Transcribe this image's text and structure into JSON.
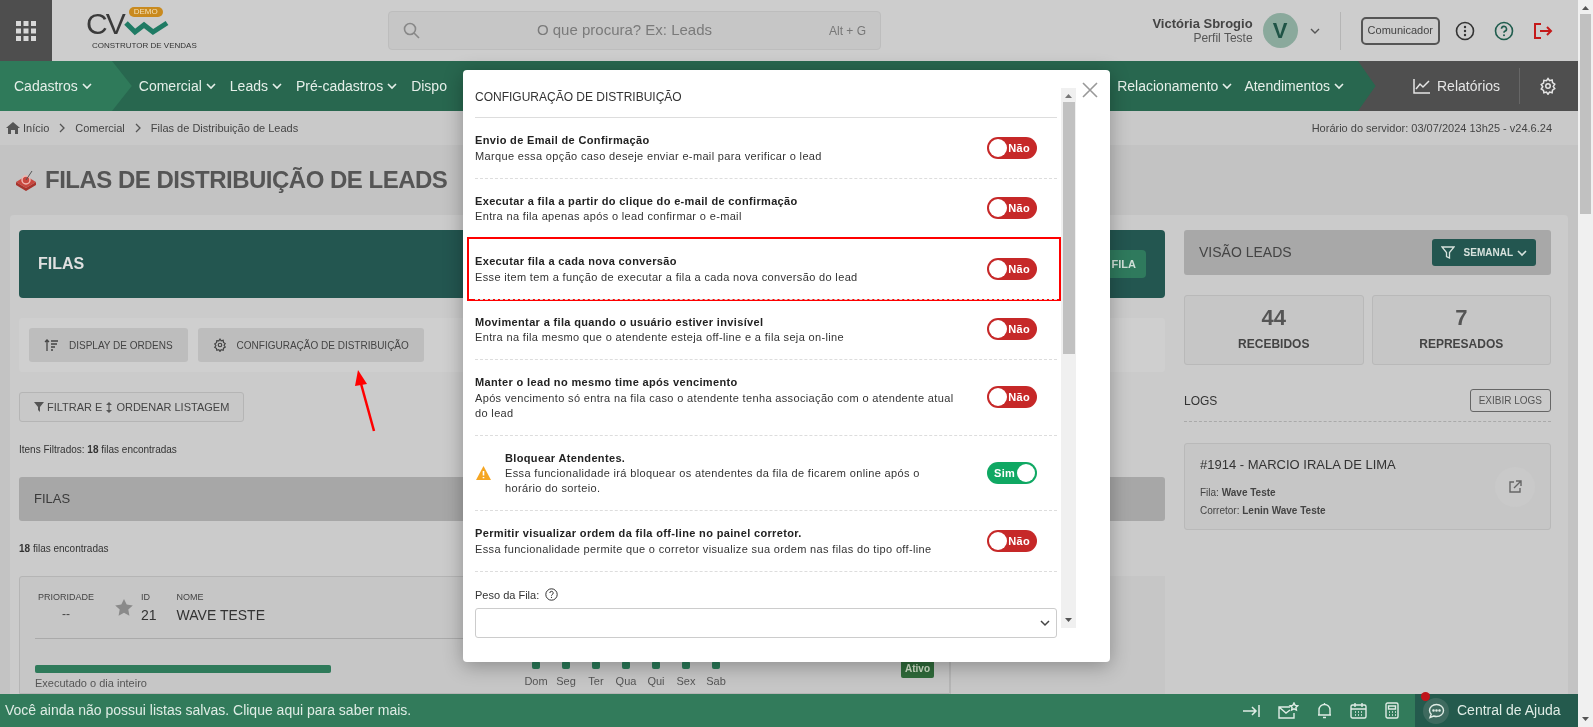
{
  "header": {
    "logo": {
      "mark": "CV",
      "badge": "DEMO",
      "tagline": "CONSTRUTOR DE VENDAS"
    },
    "search": {
      "placeholder": "O que procura? Ex: Leads",
      "shortcut": "Alt + G"
    },
    "user": {
      "name": "Victória Sbrogio",
      "profile": "Perfil Teste",
      "initial": "V"
    },
    "communicator": "Comunicador"
  },
  "nav": {
    "items": [
      {
        "label": "Cadastros",
        "menu": true,
        "selected": true
      },
      {
        "label": "Comercial",
        "menu": true,
        "selected": false
      },
      {
        "label": "Leads",
        "menu": true,
        "selected": false
      },
      {
        "label": "Pré-cadastros",
        "menu": true,
        "selected": false
      },
      {
        "label": "Dispo",
        "menu": false,
        "selected": false
      }
    ],
    "right_items": [
      {
        "label": "Relacionamento",
        "menu": true
      },
      {
        "label": "Atendimentos",
        "menu": true
      }
    ],
    "reports": "Relatórios"
  },
  "breadcrumb": [
    "Início",
    "Comercial",
    "Filas de Distribuição de Leads"
  ],
  "server_time": "Horário do servidor: 03/07/2024 13h25 - v24.6.24",
  "page_title": "FILAS DE DISTRIBUIÇÃO DE LEADS",
  "filas_header": {
    "title": "FILAS",
    "button": "FILA"
  },
  "toolbar": [
    "DISPLAY DE ORDENS",
    "CONFIGURAÇÃO DE DISTRIBUIÇÃO"
  ],
  "filter_button": {
    "left": "FILTRAR E",
    "right": "ORDENAR LISTAGEM"
  },
  "filtered": "Itens Filtrados: **18** filas encontradas",
  "list_title": "FILAS",
  "found": "**18** filas encontradas",
  "queue": {
    "priority_label": "PRIORIDADE",
    "priority": "--",
    "starred": false,
    "id_label": "ID",
    "id": "21",
    "name_label": "NOME",
    "name": "WAVE TESTE",
    "level": 1,
    "schedule": "Executado o dia inteiro",
    "days": [
      {
        "label": "Dom",
        "active": true
      },
      {
        "label": "Seg",
        "active": true
      },
      {
        "label": "Ter",
        "active": true
      },
      {
        "label": "Qua",
        "active": true
      },
      {
        "label": "Qui",
        "active": true
      },
      {
        "label": "Sex",
        "active": true
      },
      {
        "label": "Sab",
        "active": true
      }
    ],
    "status": "Ativo"
  },
  "leads_view": {
    "title": "VISÃO LEADS",
    "filter": "SEMANAL",
    "stats": [
      {
        "value": "44",
        "label": "RECEBIDOS"
      },
      {
        "value": "7",
        "label": "REPRESADOS"
      }
    ]
  },
  "logs": {
    "title": "LOGS",
    "button": "EXIBIR LOGS",
    "entries": [
      {
        "title": "#1914 - MARCIO IRALA DE LIMA",
        "queue_label": "Fila:",
        "queue": "Wave Teste",
        "broker_label": "Corretor:",
        "broker": "Lenin Wave Teste"
      }
    ]
  },
  "modal": {
    "title": "CONFIGURAÇÃO DE DISTRIBUIÇÃO",
    "options": [
      {
        "kind": "plain",
        "title": "Envio de Email de Confirmação",
        "description": "Marque essa opção caso deseje enviar e-mail para verificar o lead",
        "on": false,
        "state": "Não",
        "highlighted": false
      },
      {
        "kind": "plain",
        "title": "Executar a fila a partir do clique do e-mail de confirmação",
        "description": "Entra na fila apenas após o lead confirmar o e-mail",
        "on": false,
        "state": "Não",
        "highlighted": false
      },
      {
        "kind": "plain",
        "title": "Executar fila a cada nova conversão",
        "description": "Esse item tem a função de executar a fila a cada nova conversão do lead",
        "on": false,
        "state": "Não",
        "highlighted": true
      },
      {
        "kind": "plain",
        "title": "Movimentar a fila quando o usuário estiver invisível",
        "description": "Entra na fila mesmo que o atendente esteja off-line e a fila seja on-line",
        "on": false,
        "state": "Não",
        "highlighted": false
      },
      {
        "kind": "plain",
        "title": "Manter o lead no mesmo time após vencimento",
        "description": "Após vencimento só entra na fila caso o atendente tenha associação com o atendente atual do lead",
        "on": false,
        "state": "Não",
        "highlighted": false
      },
      {
        "kind": "warning",
        "title": "Bloquear Atendentes.",
        "description": "Essa funcionalidade irá bloquear os atendentes da fila de ficarem online após o horário do sorteio.",
        "on": true,
        "state": "Sim",
        "highlighted": false
      },
      {
        "kind": "plain",
        "title": "Permitir visualizar ordem da fila off-line no painel corretor.",
        "description": "Essa funcionalidade permite que o corretor visualize sua ordem nas filas do tipo off-line",
        "on": false,
        "state": "Não",
        "highlighted": false
      }
    ],
    "weight_label": "Peso da Fila:"
  },
  "footer": {
    "message": "Você ainda não possui listas salvas. Clique aqui para saber mais.",
    "help": "Central de Ajuda",
    "help_notification": true
  }
}
